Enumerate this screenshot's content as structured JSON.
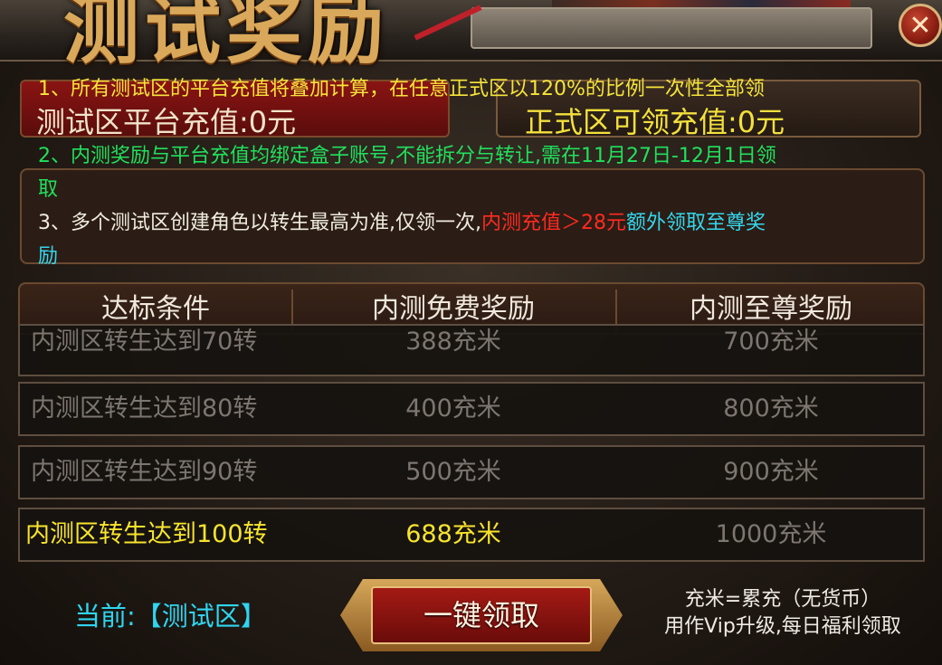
{
  "header": {
    "title": "测试奖励",
    "close_icon": "close-icon",
    "close_glyph": "✕"
  },
  "panels": {
    "test_recharge": "测试区平台充值:0元",
    "official_recharge": "正式区可领充值:0元"
  },
  "notes": {
    "line1": "1、所有测试区的平台充值将叠加计算，在任意正式区以120%的比例一次性全部领",
    "line2": "2、内测奖励与平台充值均绑定盒子账号,不能拆分与转让,需在11月27日-12月1日领",
    "line2b": "取",
    "line3a": "3、多个测试区创建角色以转生最高为准,仅领一次,",
    "line3b": "内测充值＞28元",
    "line3c": "额外领取至尊奖",
    "line3d": "励"
  },
  "table": {
    "headers": [
      "达标条件",
      "内测免费奖励",
      "内测至尊奖励"
    ],
    "rows": [
      {
        "condition": "内测区转生达到70转",
        "free": "388充米",
        "premium": "700充米"
      },
      {
        "condition": "内测区转生达到80转",
        "free": "400充米",
        "premium": "800充米"
      },
      {
        "condition": "内测区转生达到90转",
        "free": "500充米",
        "premium": "900充米"
      },
      {
        "condition": "内测区转生达到100转",
        "free": "688充米",
        "premium": "1000充米"
      }
    ]
  },
  "footer": {
    "current_label": "当前:【测试区】",
    "claim_button": "一键领取",
    "tip_line1": "充米=累充（无货币）",
    "tip_line2": "用作Vip升级,每日福利领取"
  },
  "colors": {
    "highlight_yellow": "#f5e43a",
    "note_green": "#21e05c",
    "warning_red": "#ff2a22",
    "info_cyan": "#34d6ee"
  }
}
